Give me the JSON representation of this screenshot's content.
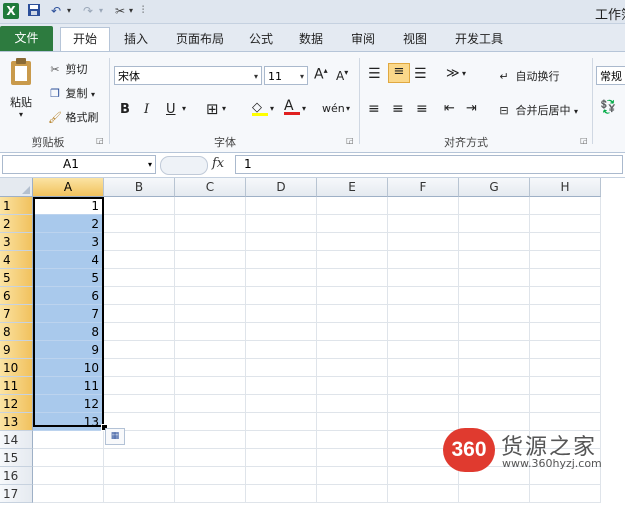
{
  "window": {
    "title": "工作簿"
  },
  "quick_access": {
    "icons": [
      "excel-icon",
      "save-icon",
      "undo-icon",
      "redo-icon",
      "customize-icon"
    ]
  },
  "tabs": [
    "文件",
    "开始",
    "插入",
    "页面布局",
    "公式",
    "数据",
    "审阅",
    "视图",
    "开发工具"
  ],
  "ribbon": {
    "clipboard": {
      "label": "剪贴板",
      "paste": "粘贴",
      "cut": "剪切",
      "copy": "复制",
      "format_painter": "格式刷"
    },
    "font": {
      "label": "字体",
      "name": "宋体",
      "size": "11",
      "bold": "B",
      "italic": "I",
      "underline": "U",
      "grow": "A",
      "shrink": "A",
      "wen": "wén"
    },
    "alignment": {
      "label": "对齐方式",
      "wrap": "自动换行",
      "merge": "合并后居中"
    },
    "number": {
      "format": "常规"
    }
  },
  "formula_bar": {
    "name_box": "A1",
    "fx": "fx",
    "value": "1"
  },
  "grid": {
    "columns": [
      "A",
      "B",
      "C",
      "D",
      "E",
      "F",
      "G",
      "H"
    ],
    "rows": [
      "1",
      "2",
      "3",
      "4",
      "5",
      "6",
      "7",
      "8",
      "9",
      "10",
      "11",
      "12",
      "13",
      "14",
      "15",
      "16",
      "17"
    ],
    "colA_values": [
      "1",
      "2",
      "3",
      "4",
      "5",
      "6",
      "7",
      "8",
      "9",
      "10",
      "11",
      "12",
      "13"
    ]
  },
  "watermark": {
    "logo": "360",
    "text": "货源之家",
    "url": "www.360hyzj.com"
  },
  "colors": {
    "accent": "#2d7b3f",
    "selection": "#a9c9ec",
    "header_selected": "#f1c15d"
  }
}
